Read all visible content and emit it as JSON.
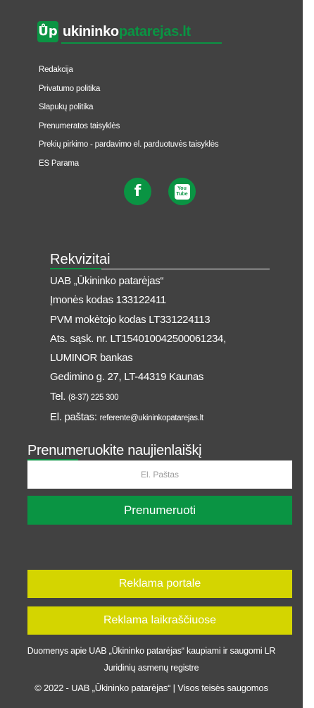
{
  "logo": {
    "mark": "Ůp",
    "part1": "ukininko",
    "part2": "patarejas.lt",
    "brand_color": "#0a9443"
  },
  "links": [
    "Redakcija",
    "Privatumo politika",
    "Slapukų politika",
    "Prenumeratos taisyklės",
    "Prekių pirkimo - pardavimo el. parduotuvės taisyklės",
    "ES Parama"
  ],
  "social": {
    "facebook_glyph": "f",
    "youtube_top": "You",
    "youtube_bottom": "Tube",
    "icons": [
      "facebook-icon",
      "youtube-icon"
    ]
  },
  "rekvizitai": {
    "title": "Rekvizitai",
    "company": "UAB „Ūkininko patarėjas“",
    "code": "Įmonės kodas 133122411",
    "vat": "PVM mokėtojo kodas LT331224113",
    "account": "Ats. sąsk. nr. LT154010042500061234,",
    "bank": "LUMINOR bankas",
    "address": "Gedimino g. 27, LT-44319 Kaunas",
    "tel_label": "Tel.",
    "tel_value": "(8-37) 225 300",
    "email_label": "El. paštas:",
    "email_value": "referente@ukininkopatarejas.lt"
  },
  "newsletter": {
    "title": "Prenumeruokite naujienlaiškį",
    "placeholder": "El. Paštas",
    "button": "Prenumeruoti"
  },
  "ads": {
    "portal": "Reklama portale",
    "newspapers": "Reklama laikraščiuose",
    "accent_color": "#d4d500"
  },
  "footer": {
    "info_line1": "Duomenys apie UAB „Ūkininko patarėjas“ kaupiami ir saugomi LR",
    "info_line2": "Juridinių asmenų registre",
    "copyright": "© 2022 - UAB „Ūkininko patarėjas“ | Visos teisės saugomos"
  }
}
